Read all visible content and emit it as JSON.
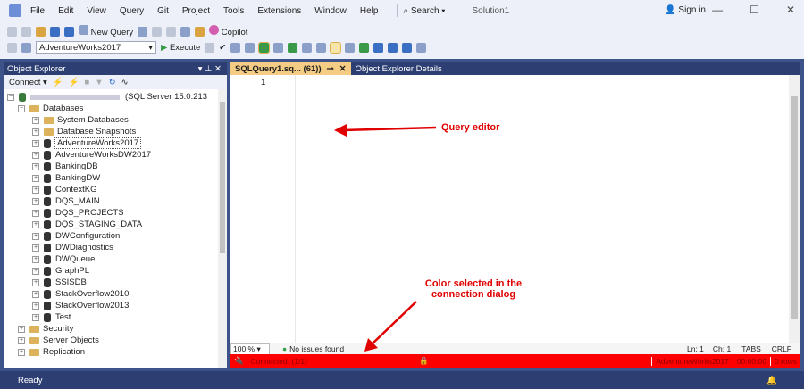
{
  "menu": [
    "File",
    "Edit",
    "View",
    "Query",
    "Git",
    "Project",
    "Tools",
    "Extensions",
    "Window",
    "Help"
  ],
  "search": "Search ▾",
  "solution": "Solution1",
  "signin": "Sign in",
  "toolbar": {
    "new_query": "New Query",
    "copilot": "Copilot",
    "database": "AdventureWorks2017",
    "execute": "Execute"
  },
  "object_explorer": {
    "title": "Object Explorer",
    "connect": "Connect ▾",
    "server": "(SQL Server 15.0.213",
    "databases": "Databases",
    "items": [
      "System Databases",
      "Database Snapshots",
      "AdventureWorks2017",
      "AdventureWorksDW2017",
      "BankingDB",
      "BankingDW",
      "ContextKG",
      "DQS_MAIN",
      "DQS_PROJECTS",
      "DQS_STAGING_DATA",
      "DWConfiguration",
      "DWDiagnostics",
      "DWQueue",
      "GraphPL",
      "SSISDB",
      "StackOverflow2010",
      "StackOverflow2013",
      "Test"
    ],
    "other": [
      "Security",
      "Server Objects",
      "Replication"
    ]
  },
  "tabs": {
    "active": "SQLQuery1.sq... (61))",
    "other": "Object Explorer Details"
  },
  "editor": {
    "line": "1",
    "zoom": "100 %",
    "issues": "No issues found",
    "ln": "Ln: 1",
    "ch": "Ch: 1",
    "tabs": "TABS",
    "crlf": "CRLF"
  },
  "connbar": {
    "status": "Connected. (1/1)",
    "database": "AdventureWorks2017",
    "time": "00:00:00",
    "rows": "0 rows"
  },
  "status": "Ready",
  "annotations": {
    "editor": "Query editor",
    "color": "Color selected in the connection dialog"
  },
  "colors": {
    "connection": "#ff0000",
    "tab_active": "#f5cc84",
    "chrome": "#2d3f72"
  }
}
